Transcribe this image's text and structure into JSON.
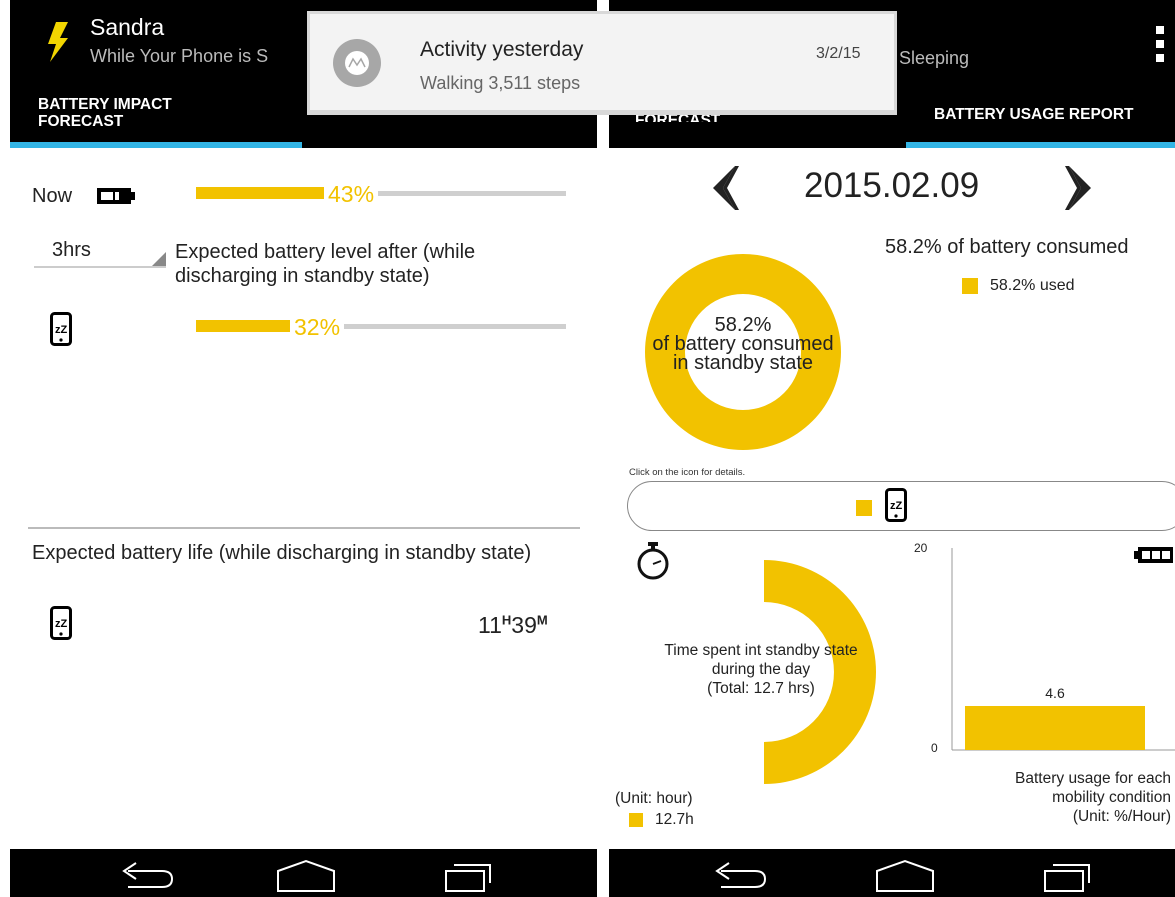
{
  "notification_left": {
    "title": "Sandra",
    "subtitle": "While Your Phone is S"
  },
  "notification_right": {
    "title": "Activity yesterday",
    "date": "3/2/15",
    "text": "Walking 3,511 steps"
  },
  "right_header": {
    "subtitle_tail": "Sleeping"
  },
  "tabs": {
    "impact": "BATTERY IMPACT\nFORECAST",
    "impact_short": "FORECAST",
    "usage": "BATTERY USAGE REPORT"
  },
  "forecast": {
    "now_label": "Now",
    "now_pct_text": "43%",
    "now_level": 0.43,
    "duration_select": "3hrs",
    "expected_label": "Expected battery level after (while discharging in standby state)",
    "after_pct_text": "32%",
    "after_level": 0.32,
    "life_label": "Expected battery life (while discharging in standby state)",
    "life_hours": "11",
    "life_hours_unit": "H",
    "life_minutes": "39",
    "life_minutes_unit": "M"
  },
  "report": {
    "date": "2015.02.09",
    "consumed_title": "58.2% of battery consumed",
    "legend_used": "58.2% used",
    "donut_pct": "58.2%",
    "donut_line1": "of battery consumed",
    "donut_line2": "in standby state",
    "hint": "Click on the icon for details.",
    "time_line1": "Time spent int standby state",
    "time_line2": "during the day",
    "time_line3": "(Total: 12.7 hrs)",
    "time_unit": "(Unit: hour)",
    "time_legend": "12.7h",
    "usage_caption1": "Battery usage for each",
    "usage_caption2": "mobility condition",
    "usage_caption3": "(Unit: %/Hour)"
  },
  "colors": {
    "accent": "#f2c200",
    "tab_indicator": "#33b5e5",
    "bar_bg": "#cfcfcf"
  },
  "chart_data": [
    {
      "type": "pie",
      "categories": [
        "used"
      ],
      "values": [
        58.2
      ],
      "title": "58.2% of battery consumed"
    },
    {
      "type": "pie",
      "categories": [
        "standby"
      ],
      "values": [
        12.7
      ],
      "title": "Time spent int standby state during the day"
    },
    {
      "type": "bar",
      "categories": [
        ""
      ],
      "values": [
        4.6
      ],
      "ylim": [
        0,
        20
      ],
      "title": "Battery usage for each mobility condition",
      "ylabel": "(Unit: %/Hour)",
      "yticks": [
        "0",
        "20"
      ]
    }
  ]
}
